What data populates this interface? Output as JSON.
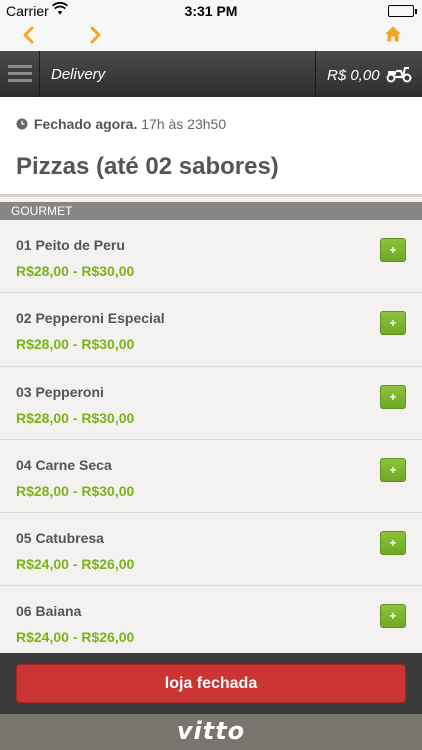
{
  "status_bar": {
    "carrier": "Carrier",
    "time": "3:31 PM"
  },
  "navbar": {
    "icons": [
      "chevron-left-icon",
      "chevron-right-icon",
      "home-icon"
    ],
    "accent": "#f5a623"
  },
  "header": {
    "title": "Delivery",
    "cart_total": "R$ 0,00"
  },
  "store_status": {
    "label": "Fechado agora.",
    "hours": "17h às 23h50"
  },
  "category": {
    "title": "Pizzas (até 02 sabores)",
    "section": "GOURMET"
  },
  "products": [
    {
      "name": "01 Peito de Peru",
      "price": "R$28,00 - R$30,00",
      "add_label": "+"
    },
    {
      "name": "02 Pepperoni Especial",
      "price": "R$28,00 - R$30,00",
      "add_label": "+"
    },
    {
      "name": "03 Pepperoni",
      "price": "R$28,00 - R$30,00",
      "add_label": "+"
    },
    {
      "name": "04 Carne Seca",
      "price": "R$28,00 - R$30,00",
      "add_label": "+"
    },
    {
      "name": "05 Catubresa",
      "price": "R$24,00 - R$26,00",
      "add_label": "+"
    },
    {
      "name": "06 Baiana",
      "price": "R$24,00 - R$26,00",
      "add_label": "+"
    }
  ],
  "footer": {
    "button_label": "loja fechada"
  },
  "brand": {
    "logo": "vitto"
  },
  "colors": {
    "price": "#7cb219",
    "add_button": "#7db42d",
    "closed_button": "#cc3333",
    "header": "#3a3a3a"
  }
}
